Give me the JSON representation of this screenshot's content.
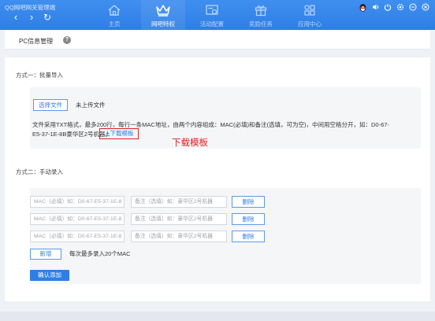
{
  "app": {
    "title": "QQ网吧网关管理端"
  },
  "nav": {
    "back": "‹",
    "forward": "›",
    "refresh": "↻",
    "tabs": [
      {
        "label": "主页",
        "icon": "home-icon",
        "active": false
      },
      {
        "label": "网吧特权",
        "icon": "crown-icon",
        "active": true
      },
      {
        "label": "活动配置",
        "icon": "settings-board-icon",
        "active": false
      },
      {
        "label": "奖励任务",
        "icon": "gift-icon",
        "active": false
      },
      {
        "label": "应用中心",
        "icon": "apps-icon",
        "active": false
      }
    ]
  },
  "window_controls": [
    "qq-penguin-icon",
    "volume-icon",
    "power-icon",
    "gear-icon",
    "minimize-icon",
    "close-icon"
  ],
  "page": {
    "title": "PC信息管理",
    "help": "?"
  },
  "section1": {
    "title": "方式一：批量导入",
    "choose_file": "选择文件",
    "file_status": "未上传文件",
    "desc_line1": "文件采用TXT格式，最多200行，每行一条MAC地址，由两个内容组成：MAC(必填)和备注(选填，可为空)，中间用空格分开，如：D0-67-",
    "desc_line2": "E5-37-1E-8B豪华区2号机器。",
    "download_link": "下载模板",
    "download_annotation": "下载模板"
  },
  "section2": {
    "title": "方式二：手动录入",
    "rows": [
      {
        "mac_placeholder": "MAC（必填）如：D0-67-E5-37-1E-8",
        "note_placeholder": "备注（选填）如：豪华区2号机器",
        "delete": "删除"
      },
      {
        "mac_placeholder": "MAC（必填）如：D0-67-E5-37-1E-8",
        "note_placeholder": "备注（选填）如：豪华区2号机器",
        "delete": "删除"
      },
      {
        "mac_placeholder": "MAC（必填）如：D0-67-E5-37-1E-8",
        "note_placeholder": "备注（选填）如：豪华区2号机器",
        "delete": "删除"
      }
    ],
    "add_button": "新增",
    "limit_note": "每次最多录入20个MAC",
    "confirm_button": "确认添加"
  },
  "colors": {
    "accent": "#2f7ee6",
    "topbar": "#3f8ff0",
    "annotation": "#e02020"
  }
}
